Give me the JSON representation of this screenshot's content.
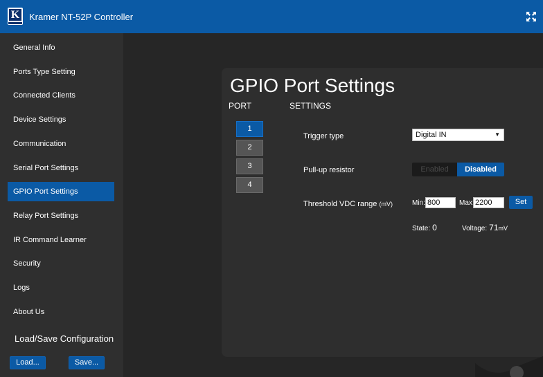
{
  "header": {
    "title": "Kramer NT-52P Controller",
    "logo_letter": "K",
    "expand_icon": "expand-icon",
    "color": "#0b5aa5"
  },
  "sidebar": {
    "items": [
      {
        "label": "General Info",
        "active": false
      },
      {
        "label": "Ports Type Setting",
        "active": false
      },
      {
        "label": "Connected Clients",
        "active": false
      },
      {
        "label": "Device Settings",
        "active": false
      },
      {
        "label": "Communication",
        "active": false
      },
      {
        "label": "Serial Port Settings",
        "active": false
      },
      {
        "label": "GPIO Port Settings",
        "active": true
      },
      {
        "label": "Relay Port Settings",
        "active": false
      },
      {
        "label": "IR Command Learner",
        "active": false
      },
      {
        "label": "Security",
        "active": false
      },
      {
        "label": "Logs",
        "active": false
      },
      {
        "label": "About Us",
        "active": false
      }
    ],
    "load_save_title": "Load/Save Configuration",
    "load_label": "Load...",
    "save_label": "Save..."
  },
  "main": {
    "title": "GPIO Port Settings",
    "port_header": "PORT",
    "settings_header": "SETTINGS",
    "ports": [
      {
        "label": "1",
        "active": true
      },
      {
        "label": "2",
        "active": false
      },
      {
        "label": "3",
        "active": false
      },
      {
        "label": "4",
        "active": false
      }
    ],
    "trigger_type": {
      "label": "Trigger type",
      "value": "Digital IN"
    },
    "pullup": {
      "label": "Pull-up resistor",
      "enabled_label": "Enabled",
      "disabled_label": "Disabled",
      "selected": "Disabled"
    },
    "threshold": {
      "label": "Threshold VDC range",
      "unit": "(mV)",
      "min_label": "Min:",
      "min_value": "800",
      "max_label": "Max:",
      "max_value": "2200",
      "set_label": "Set"
    },
    "state": {
      "label": "State:",
      "value": "0"
    },
    "voltage": {
      "label": "Voltage:",
      "value": "71",
      "unit": "mV"
    }
  }
}
